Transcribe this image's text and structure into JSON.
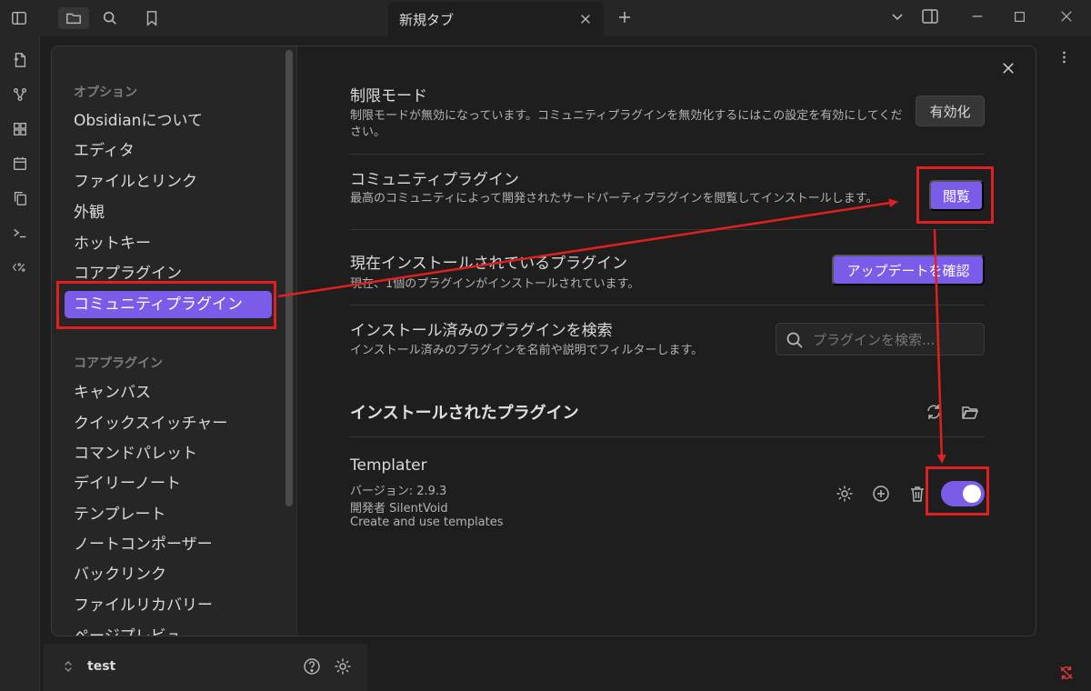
{
  "tab": {
    "title": "新規タブ"
  },
  "vault": {
    "name": "test"
  },
  "sidebar": {
    "headings": {
      "options": "オプション",
      "core": "コアプラグイン"
    },
    "options_items": [
      "Obsidianについて",
      "エディタ",
      "ファイルとリンク",
      "外観",
      "ホットキー",
      "コアプラグイン",
      "コミュニティプラグイン"
    ],
    "core_items": [
      "キャンバス",
      "クイックスイッチャー",
      "コマンドパレット",
      "デイリーノート",
      "テンプレート",
      "ノートコンポーザー",
      "バックリンク",
      "ファイルリカバリー",
      "ページプレビュ..."
    ]
  },
  "settings": {
    "restricted": {
      "name": "制限モード",
      "desc": "制限モードが無効になっています。コミュニティプラグインを無効化するにはこの設定を有効にしてください。",
      "button": "有効化"
    },
    "community": {
      "name": "コミュニティプラグイン",
      "desc": "最高のコミュニティによって開発されたサードパーティプラグインを閲覧してインストールします。",
      "button": "閲覧"
    },
    "installed": {
      "name": "現在インストールされているプラグイン",
      "desc": "現在、1個のプラグインがインストールされています。",
      "button": "アップデートを確認"
    },
    "search": {
      "name": "インストール済みのプラグインを検索",
      "desc": "インストール済みのプラグインを名前や説明でフィルターします。",
      "placeholder": "プラグインを検索..."
    }
  },
  "installed_section": {
    "title": "インストールされたプラグイン"
  },
  "plugin": {
    "name": "Templater",
    "version": "バージョン: 2.9.3",
    "author": "開発者 SilentVoid",
    "desc": "Create and use templates",
    "enabled": true
  },
  "colors": {
    "accent": "#7b5ce8",
    "annotation": "#e02020",
    "background": "#1e1e1e"
  },
  "icons": {
    "titlebar": [
      "sidebar-toggle-icon",
      "folder-icon",
      "search-icon",
      "bookmark-icon"
    ],
    "ribbon": [
      "file-plus-icon",
      "graph-icon",
      "grid-icon",
      "calendar-icon",
      "copy-icon",
      "terminal-icon",
      "percent-tag-icon"
    ]
  }
}
